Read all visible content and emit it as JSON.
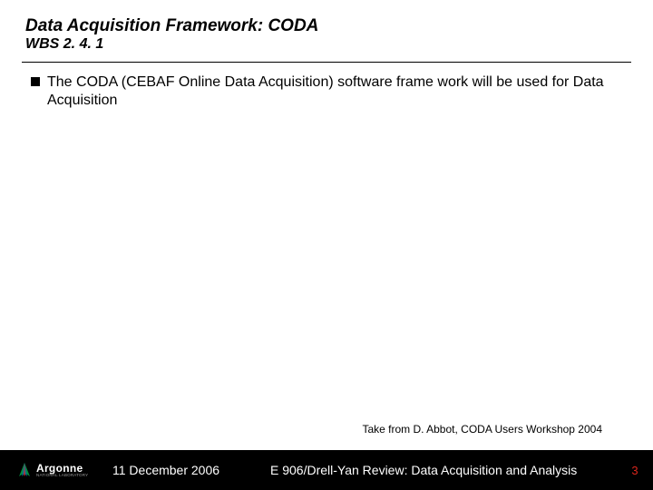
{
  "header": {
    "title": "Data Acquisition Framework:  CODA",
    "subtitle": "WBS 2. 4. 1"
  },
  "bullets": {
    "b0": "The CODA (CEBAF Online Data Acquisition) software frame work will be used for Data Acquisition"
  },
  "attribution": "Take from D. Abbot, CODA Users Workshop 2004",
  "footer": {
    "logo_name": "Argonne",
    "logo_sub": "NATIONAL LABORATORY",
    "date": "11 December 2006",
    "title": "E 906/Drell-Yan Review:  Data Acquisition and Analysis",
    "page": "3"
  }
}
